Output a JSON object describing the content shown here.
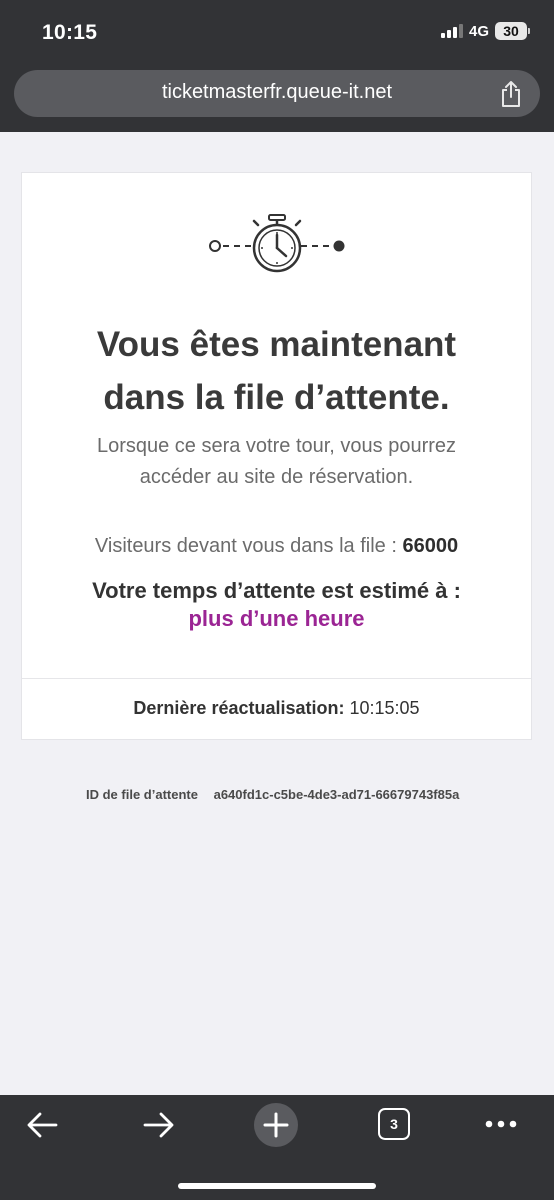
{
  "status_bar": {
    "time": "10:15",
    "network": "4G",
    "battery": "30"
  },
  "browser": {
    "url": "ticketmasterfr.queue-it.net",
    "tab_count": "3"
  },
  "queue": {
    "title_line1": "Vous êtes maintenant",
    "title_line2": "dans la file d’attente.",
    "subtitle_line1": "Lorsque ce sera votre tour, vous pourrez",
    "subtitle_line2": "accéder au site de réservation.",
    "visitors_label": "Visiteurs devant vous dans la file :",
    "visitors_count": "66000",
    "wait_label": "Votre temps d’attente est estimé à :",
    "wait_value": "plus d’une heure",
    "refresh_label": "Dernière réactualisation:",
    "refresh_time": "10:15:05",
    "queue_id_label": "ID de file d’attente",
    "queue_id_value": "a640fd1c-c5be-4de3-ad71-66679743f85a"
  },
  "colors": {
    "accent": "#9b2594",
    "chrome": "#323336"
  },
  "icons": {
    "share": "share-icon",
    "back": "arrow-left-icon",
    "forward": "arrow-right-icon",
    "new_tab": "plus-icon",
    "tabs": "tab-switcher-icon",
    "more": "more-dots-icon",
    "stopwatch": "stopwatch-icon"
  }
}
